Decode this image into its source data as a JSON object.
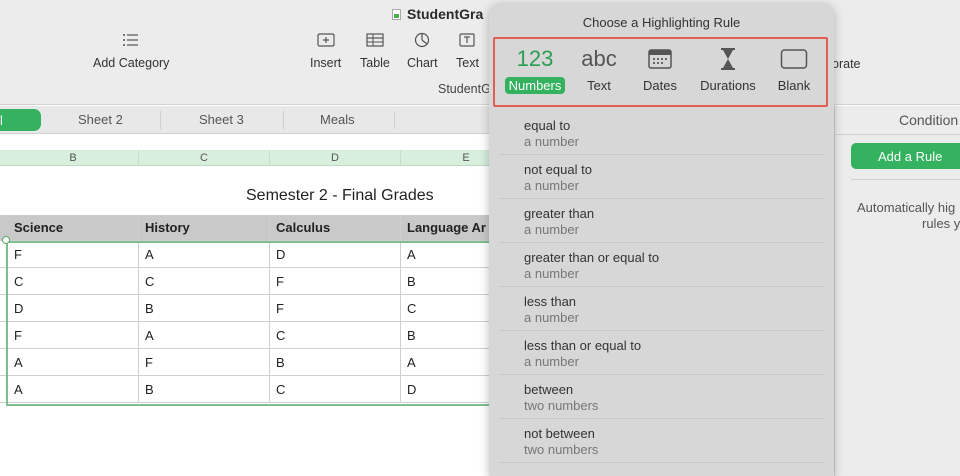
{
  "toolbar": {
    "doc_title": "StudentGra",
    "doc_subtitle": "StudentG",
    "collab_fragment": "orate",
    "add_category": "Add Category",
    "insert": "Insert",
    "table": "Table",
    "chart": "Chart",
    "text": "Text"
  },
  "tabs": {
    "active": "l",
    "items": [
      "Sheet 2",
      "Sheet 3",
      "Meals"
    ]
  },
  "columns": [
    "B",
    "C",
    "D",
    "E"
  ],
  "sheet_title": "Semester 2 - Final Grades",
  "table": {
    "headers": [
      "Science",
      "History",
      "Calculus",
      "Language Ar"
    ],
    "rows": [
      [
        "F",
        "A",
        "D",
        "A"
      ],
      [
        "C",
        "C",
        "F",
        "B"
      ],
      [
        "D",
        "B",
        "F",
        "C"
      ],
      [
        "F",
        "A",
        "C",
        "B"
      ],
      [
        "A",
        "F",
        "B",
        "A"
      ],
      [
        "A",
        "B",
        "C",
        "D"
      ]
    ]
  },
  "popover": {
    "title": "Choose a Highlighting Rule",
    "types": [
      {
        "glyph": "123",
        "label": "Numbers",
        "active": true
      },
      {
        "glyph": "abc",
        "label": "Text",
        "active": false
      },
      {
        "glyph": "calendar-icon",
        "label": "Dates",
        "active": false
      },
      {
        "glyph": "hourglass-icon",
        "label": "Durations",
        "active": false
      },
      {
        "glyph": "blank-box-icon",
        "label": "Blank",
        "active": false
      }
    ],
    "rules": [
      {
        "name": "equal to",
        "hint": "a number"
      },
      {
        "name": "not equal to",
        "hint": "a number"
      },
      {
        "name": "greater than",
        "hint": "a number"
      },
      {
        "name": "greater than or equal to",
        "hint": "a number"
      },
      {
        "name": "less than",
        "hint": "a number"
      },
      {
        "name": "less than or equal to",
        "hint": "a number"
      },
      {
        "name": "between",
        "hint": "two numbers"
      },
      {
        "name": "not between",
        "hint": "two numbers"
      }
    ]
  },
  "inspector": {
    "title": "Condition",
    "add_rule": "Add a Rule",
    "note_line1": "Automatically hig",
    "note_line2": "rules y"
  },
  "colors": {
    "accent": "#34b25f",
    "highlight_border": "#e35d55"
  }
}
